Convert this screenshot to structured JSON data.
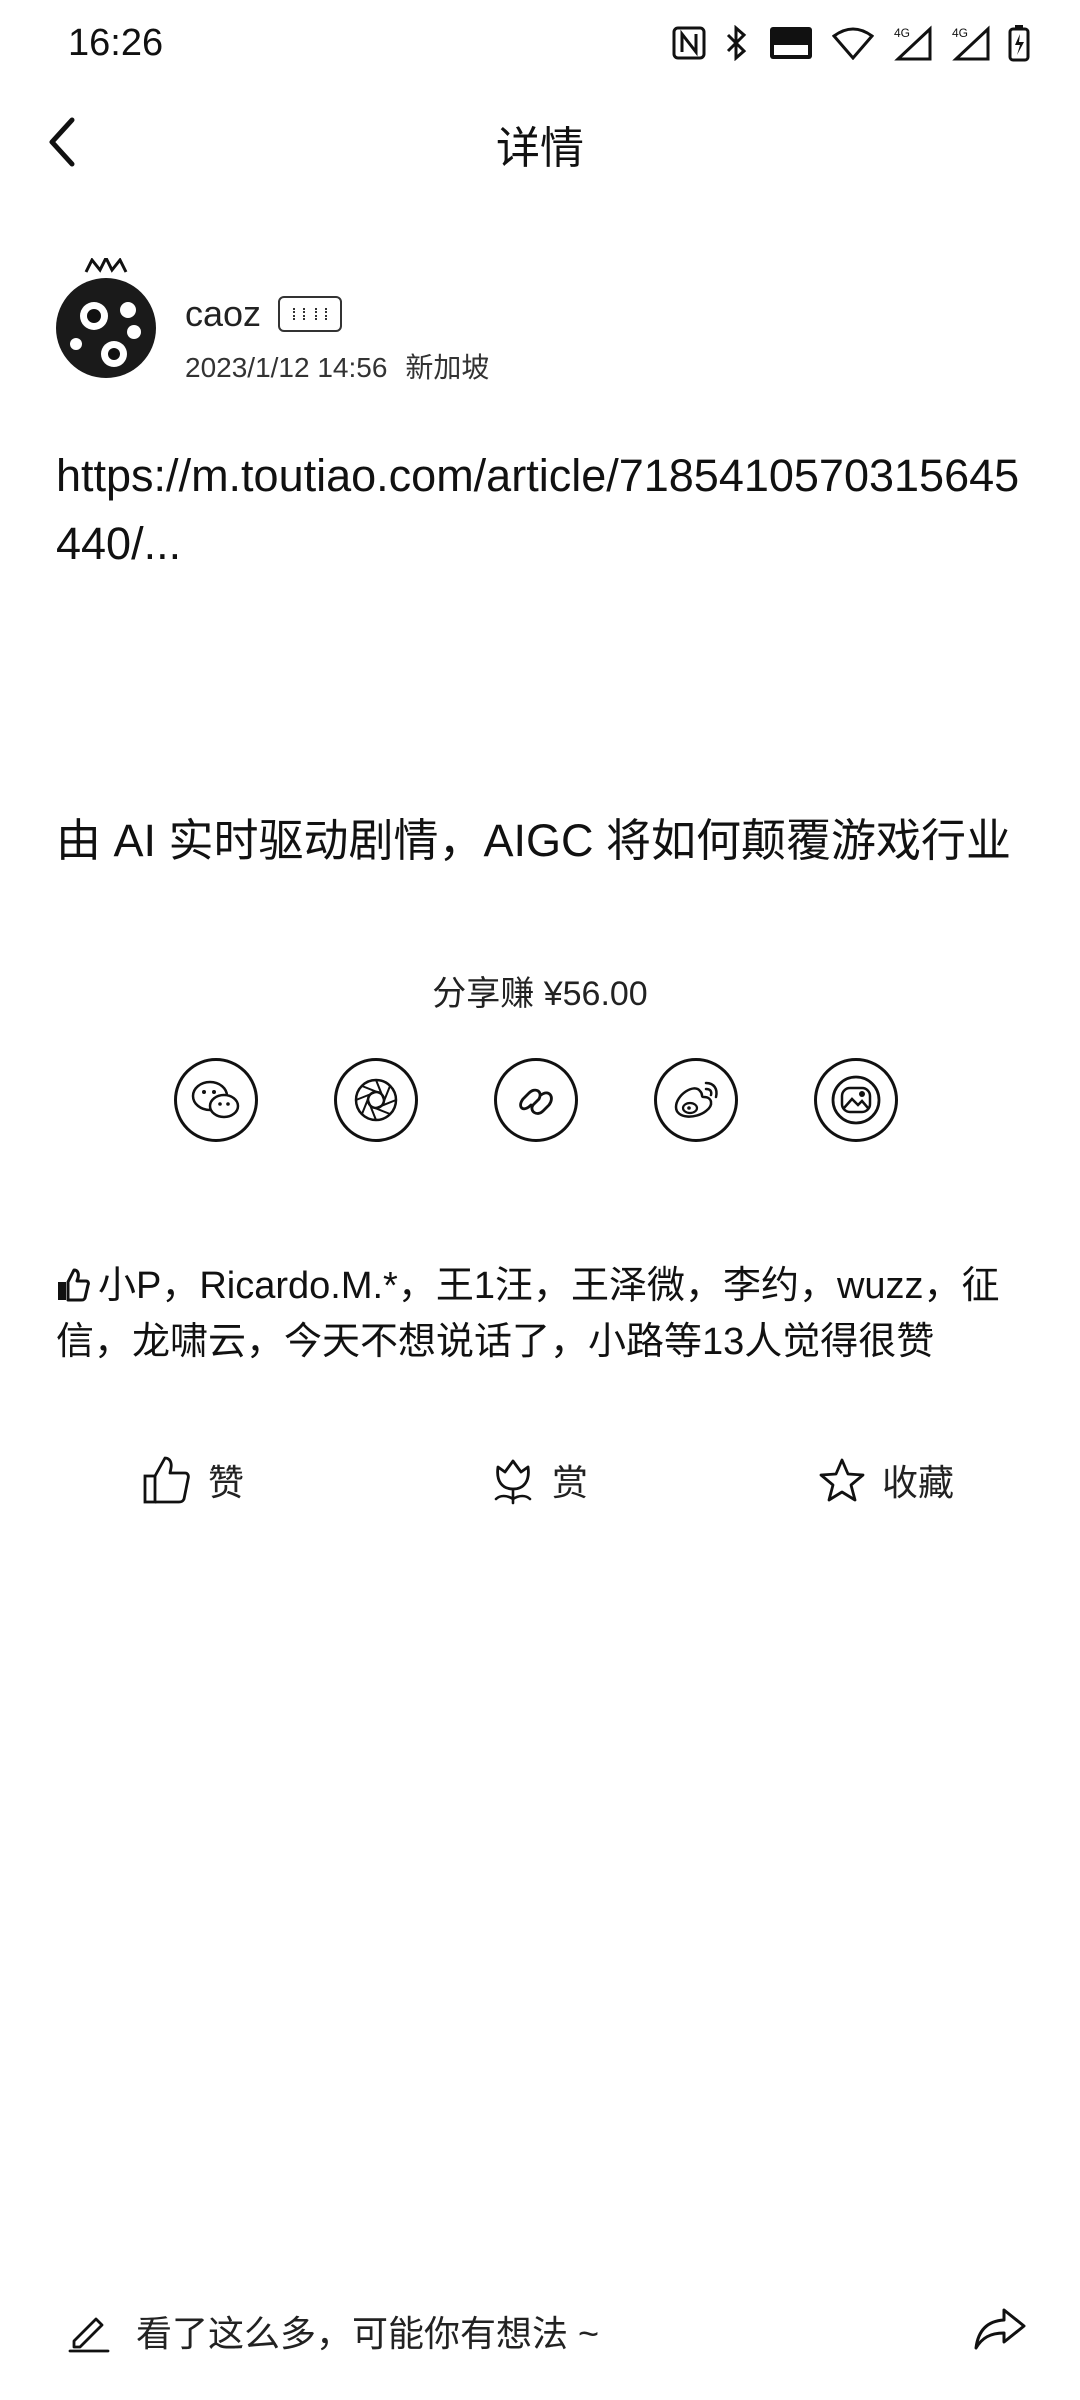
{
  "status_bar": {
    "time": "16:26"
  },
  "header": {
    "title": "详情"
  },
  "author": {
    "name": "caoz",
    "date": "2023/1/12 14:56",
    "location": "新加坡"
  },
  "post": {
    "link_text": "https://m.toutiao.com/article/7185410570315645440/...",
    "article_title": "由 AI 实时驱动剧情，AIGC 将如何颠覆游戏行业"
  },
  "share": {
    "label": "分享赚 ¥56.00",
    "buttons": [
      "wechat-icon",
      "moments-icon",
      "link-icon",
      "weibo-icon",
      "album-icon"
    ]
  },
  "likes": {
    "text": "小P，Ricardo.M.*，王1汪，王泽微，李约，wuzz，征信，龙啸云，今天不想说话了，小路等13人觉得很赞"
  },
  "actions": {
    "like": "赞",
    "reward": "赏",
    "favorite": "收藏"
  },
  "comment": {
    "placeholder": "看了这么多，可能你有想法 ~"
  }
}
